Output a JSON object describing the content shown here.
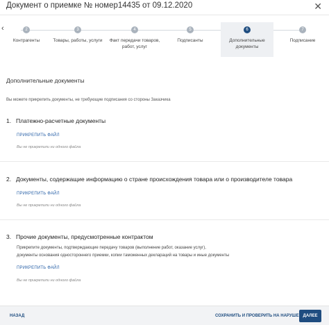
{
  "header": {
    "title": "Документ о приемке № номер14435 от 09.12.2020",
    "close_icon": "close-icon"
  },
  "stepper": {
    "back_icon": "chevron-left-icon",
    "steps": [
      {
        "number": "2",
        "label": "Контрагенты",
        "active": false
      },
      {
        "number": "3",
        "label": "Товары, работы, услуги",
        "active": false
      },
      {
        "number": "4",
        "label": "Факт передачи товаров, работ, услуг",
        "active": false
      },
      {
        "number": "5",
        "label": "Подписанты",
        "active": false
      },
      {
        "number": "6",
        "label": "Дополнительные документы",
        "active": true
      },
      {
        "number": "7",
        "label": "Подписание",
        "active": false
      }
    ],
    "colors": {
      "active": "#1f4d80",
      "inactive": "#aab3bd"
    }
  },
  "main": {
    "section_title": "Дополнительные документы",
    "intro": "Вы можете прикрепить документы, не требующие подписания со стороны Заказчика",
    "documents": [
      {
        "number": "1.",
        "title": "Платежно-расчетные документы",
        "attach_label": "ПРИКРЕПИТЬ ФАЙЛ",
        "no_file_text": "Вы не прикрепили ни одного файла"
      },
      {
        "number": "2.",
        "title": "Документы, содержащие информацию о стране происхождения товара или о производителе товара",
        "attach_label": "ПРИКРЕПИТЬ ФАЙЛ",
        "no_file_text": "Вы не прикрепили ни одного файла"
      },
      {
        "number": "3.",
        "title": "Прочие документы, предусмотренные контрактом",
        "description_1": "Прикрепите документы, подтверждающие передачу товаров (выполнение работ, оказание услуг),",
        "description_2": "документы основания одностороннего приемки, копии таможенных деклараций на товары и иные документы",
        "attach_label": "ПРИКРЕПИТЬ ФАЙЛ",
        "no_file_text": "Вы не прикрепили ни одного файла"
      }
    ]
  },
  "footer": {
    "back_label": "НАЗАД",
    "save_label": "СОХРАНИТЬ И ПРОВЕРИТЬ НА НАРУШЕНИЯ",
    "next_label": "ДАЛЕЕ",
    "accent_color": "#1f4d80"
  }
}
